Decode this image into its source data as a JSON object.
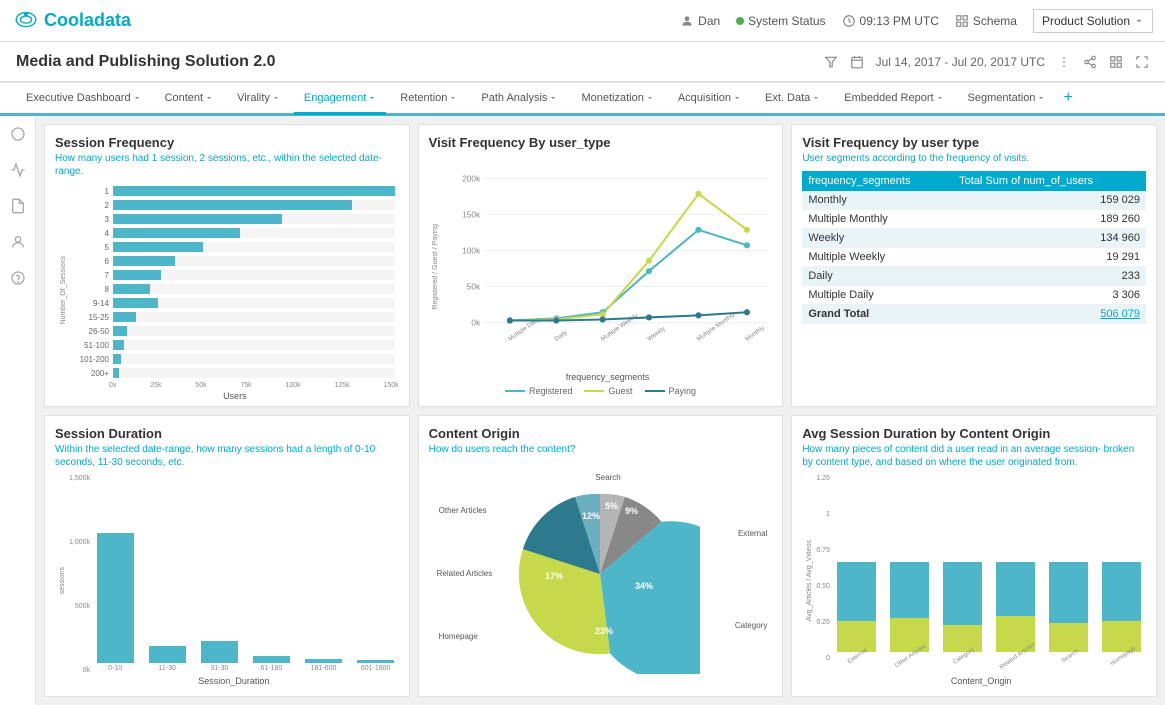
{
  "header": {
    "logo": "Cooladata",
    "user": "Dan",
    "status": "System Status",
    "time": "09:13 PM UTC",
    "schema": "Schema",
    "product": "Product Solution"
  },
  "titlebar": {
    "title": "Media and Publishing Solution 2.0",
    "date_range": "Jul 14, 2017 - Jul 20, 2017  UTC"
  },
  "secondary_nav": {
    "tabs": [
      {
        "label": "Executive Dashboard",
        "active": false
      },
      {
        "label": "Content",
        "active": false
      },
      {
        "label": "Virality",
        "active": false
      },
      {
        "label": "Engagement",
        "active": true
      },
      {
        "label": "Retention",
        "active": false
      },
      {
        "label": "Path Analysis",
        "active": false
      },
      {
        "label": "Monetization",
        "active": false
      },
      {
        "label": "Acquisition",
        "active": false
      },
      {
        "label": "Ext. Data",
        "active": false
      },
      {
        "label": "Embedded Report",
        "active": false
      },
      {
        "label": "Segmentation",
        "active": false
      }
    ]
  },
  "panels": {
    "session_frequency": {
      "title": "Session Frequency",
      "subtitle": "How many users had 1 session, 2 sessions, etc., within the selected date-range.",
      "bars": [
        {
          "label": "1",
          "pct": 100
        },
        {
          "label": "2",
          "pct": 85
        },
        {
          "label": "3",
          "pct": 60
        },
        {
          "label": "4",
          "pct": 45
        },
        {
          "label": "5",
          "pct": 32
        },
        {
          "label": "6",
          "pct": 22
        },
        {
          "label": "7",
          "pct": 17
        },
        {
          "label": "8",
          "pct": 13
        },
        {
          "label": "9-14",
          "pct": 16
        },
        {
          "label": "15-25",
          "pct": 8
        },
        {
          "label": "26-50",
          "pct": 5
        },
        {
          "label": "51-100",
          "pct": 4
        },
        {
          "label": "101-200",
          "pct": 3
        },
        {
          "label": "200+",
          "pct": 2
        }
      ],
      "x_labels": [
        "0x",
        "25k",
        "50k",
        "75k",
        "100k",
        "125k",
        "150k"
      ],
      "x_axis_label": "Users",
      "y_axis_label": "Number_Of_Sessions"
    },
    "visit_frequency_line": {
      "title": "Visit Frequency By user_type",
      "y_labels": [
        "200k",
        "150k",
        "100k",
        "50k",
        "0k"
      ],
      "y_axis_label": "Registered / Guest / Paying",
      "x_axis_label": "frequency_segments",
      "x_labels": [
        "Multiple Daily",
        "Daily",
        "Multiple Weekly",
        "Weekly",
        "Multiple Monthly",
        "Monthly"
      ],
      "legend": [
        {
          "label": "Registered",
          "color": "#4db6c8"
        },
        {
          "label": "Guest",
          "color": "#c5d94a"
        },
        {
          "label": "Paying",
          "color": "#2c5f6e"
        }
      ]
    },
    "visit_frequency_table": {
      "title": "Visit Frequency by user type",
      "subtitle": "User segments according to the frequency of visits.",
      "col1": "frequency_segments",
      "col2": "Total Sum of num_of_users",
      "rows": [
        {
          "segment": "Monthly",
          "value": "159 029"
        },
        {
          "segment": "Multiple Monthly",
          "value": "189 260"
        },
        {
          "segment": "Weekly",
          "value": "134 960"
        },
        {
          "segment": "Multiple Weekly",
          "value": "19 291"
        },
        {
          "segment": "Daily",
          "value": "233"
        },
        {
          "segment": "Multiple Daily",
          "value": "3 306"
        }
      ],
      "grand_total_label": "Grand Total",
      "grand_total_value": "506 079"
    },
    "session_duration": {
      "title": "Session Duration",
      "subtitle": "Within the selected date-range, how many sessions had a length of 0-10 seconds, 11-30 seconds, etc.",
      "y_labels": [
        "1,500k",
        "1,000k",
        "500k",
        "0k"
      ],
      "x_labels": [
        "0-10",
        "11-30",
        "31-30",
        "61-180",
        "181-600",
        "601-1800"
      ],
      "x_axis_label": "Session_Duration",
      "y_axis_label": "sessions",
      "bars_pct": [
        100,
        13,
        17,
        5,
        3,
        2
      ]
    },
    "content_origin": {
      "title": "Content Origin",
      "subtitle": "How do users reach the content?",
      "segments": [
        {
          "label": "Search",
          "pct": 5,
          "color": "#b0b0b0"
        },
        {
          "label": "Other Articles",
          "pct": 9,
          "color": "#888"
        },
        {
          "label": "External",
          "pct": 34,
          "color": "#4db6c8"
        },
        {
          "label": "Category",
          "pct": 23,
          "color": "#c5d94a"
        },
        {
          "label": "Homepage",
          "pct": 17,
          "color": "#2c7a8c"
        },
        {
          "label": "Related Articles",
          "pct": 12,
          "color": "#6ab0c0"
        }
      ]
    },
    "avg_session_duration": {
      "title": "Avg Session Duration by Content Origin",
      "subtitle": "How many pieces of content did a user read in an average session- broken by content type, and based on where the user originated from.",
      "y_labels": [
        "1.25",
        "1",
        "0.75",
        "0.50",
        "0.25",
        "0"
      ],
      "x_labels": [
        "External",
        "Other Articles",
        "Category",
        "Related Articles",
        "Search",
        "Homepage"
      ],
      "y_axis_label": "Avg_Articles / Avg_Videos",
      "x_axis_label": "Content_Origin",
      "bars": [
        {
          "blue": 65,
          "green": 35
        },
        {
          "blue": 62,
          "green": 38
        },
        {
          "blue": 70,
          "green": 30
        },
        {
          "blue": 60,
          "green": 40
        },
        {
          "blue": 68,
          "green": 32
        },
        {
          "blue": 65,
          "green": 35
        }
      ]
    }
  }
}
